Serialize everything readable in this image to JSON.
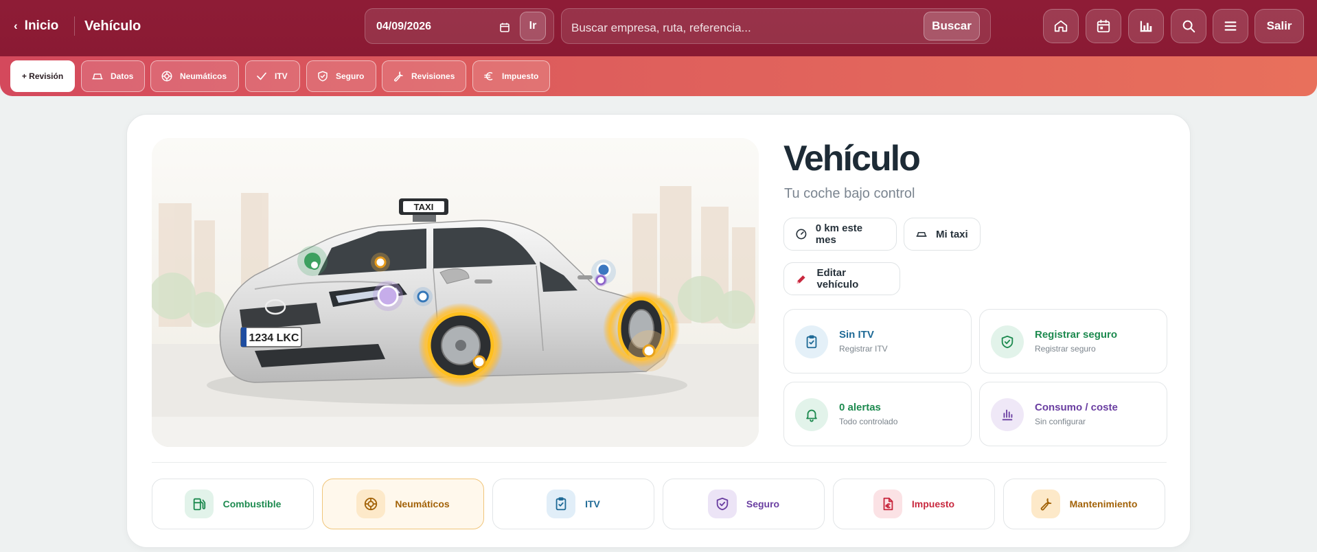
{
  "topbar": {
    "back_label": "Inicio",
    "page_title": "Vehículo",
    "date_value": "04/09/2026",
    "go_label": "Ir",
    "search_placeholder": "Buscar empresa, ruta, referencia...",
    "search_button": "Buscar",
    "exit_label": "Salir"
  },
  "subnav": {
    "primary": "+ Revisión",
    "items": [
      {
        "label": "Datos",
        "icon": "car-icon"
      },
      {
        "label": "Neumáticos",
        "icon": "tire-icon"
      },
      {
        "label": "ITV",
        "icon": "check-icon"
      },
      {
        "label": "Seguro",
        "icon": "shield-check-icon"
      },
      {
        "label": "Revisiones",
        "icon": "wrench-icon"
      },
      {
        "label": "Impuesto",
        "icon": "euro-icon"
      }
    ]
  },
  "vehicle": {
    "title": "Vehículo",
    "subtitle": "Tu coche bajo control",
    "km_pill": "0 km este mes",
    "name_pill": "Mi taxi",
    "edit_button": "Editar vehículo",
    "plate": "1234 LKC",
    "roof_sign": "TAXI"
  },
  "status_cards": [
    {
      "title": "Sin ITV",
      "subtitle": "Registrar ITV",
      "color": "#1f6a96",
      "bg": "#e4f0f8",
      "icon": "clipboard-icon"
    },
    {
      "title": "Registrar seguro",
      "subtitle": "Registrar seguro",
      "color": "#1d8a4f",
      "bg": "#e2f3ea",
      "icon": "shield-check-icon"
    },
    {
      "title": "0 alertas",
      "subtitle": "Todo controlado",
      "color": "#1d8a4f",
      "bg": "#e2f3ea",
      "icon": "bell-icon"
    },
    {
      "title": "Consumo / coste",
      "subtitle": "Sin configurar",
      "color": "#6a3ea1",
      "bg": "#efe8f7",
      "icon": "bar-chart-icon"
    }
  ],
  "tiles": [
    {
      "label": "Combustible",
      "color": "#1d8a4f",
      "bg": "#e2f3ea",
      "icon": "fuel-icon"
    },
    {
      "label": "Neumáticos",
      "color": "#a26208",
      "bg": "#fde9c9",
      "icon": "tire-icon",
      "active": true
    },
    {
      "label": "ITV",
      "color": "#1f6a96",
      "bg": "#e1eef8",
      "icon": "clipboard-icon"
    },
    {
      "label": "Seguro",
      "color": "#6a3ea1",
      "bg": "#ece4f6",
      "icon": "shield-check-icon"
    },
    {
      "label": "Impuesto",
      "color": "#c8283e",
      "bg": "#fbe2e5",
      "icon": "document-euro-icon"
    },
    {
      "label": "Mantenimiento",
      "color": "#a26208",
      "bg": "#fde9c9",
      "icon": "wrench-icon"
    }
  ]
}
